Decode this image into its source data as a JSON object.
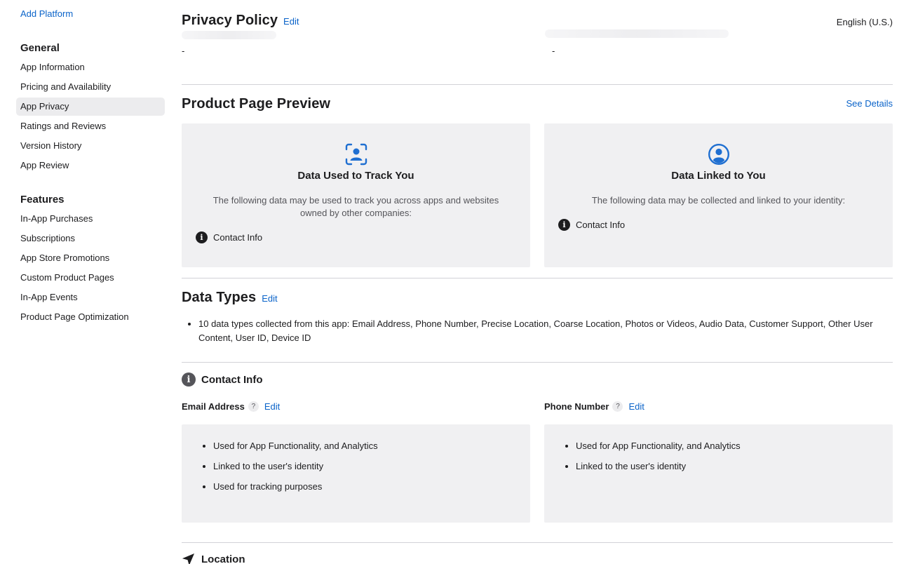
{
  "sidebar": {
    "add_platform": "Add Platform",
    "general_title": "General",
    "general_items": [
      "App Information",
      "Pricing and Availability",
      "App Privacy",
      "Ratings and Reviews",
      "Version History",
      "App Review"
    ],
    "features_title": "Features",
    "features_items": [
      "In-App Purchases",
      "Subscriptions",
      "App Store Promotions",
      "Custom Product Pages",
      "In-App Events",
      "Product Page Optimization"
    ],
    "active_item": "App Privacy"
  },
  "privacy_policy": {
    "title": "Privacy Policy",
    "edit": "Edit",
    "language": "English (U.S.)",
    "url_value": "-",
    "choices_url_value": "-"
  },
  "product_page_preview": {
    "title": "Product Page Preview",
    "see_details": "See Details",
    "track_card": {
      "icon": "person-viewfinder-icon",
      "title": "Data Used to Track You",
      "description": "The following data may be used to track you across apps and websites owned by other companies:",
      "item": "Contact Info"
    },
    "linked_card": {
      "icon": "person-circle-icon",
      "title": "Data Linked to You",
      "description": "The following data may be collected and linked to your identity:",
      "item": "Contact Info"
    }
  },
  "data_types": {
    "title": "Data Types",
    "edit": "Edit",
    "summary": "10 data types collected from this app: Email Address, Phone Number, Precise Location, Coarse Location, Photos or Videos, Audio Data, Customer Support, Other User Content, User ID, Device ID"
  },
  "contact_info": {
    "title": "Contact Info",
    "email": {
      "label": "Email Address",
      "help": "?",
      "edit": "Edit",
      "uses": [
        "Used for App Functionality, and Analytics",
        "Linked to the user's identity",
        "Used for tracking purposes"
      ]
    },
    "phone": {
      "label": "Phone Number",
      "help": "?",
      "edit": "Edit",
      "uses": [
        "Used for App Functionality, and Analytics",
        "Linked to the user's identity"
      ]
    }
  },
  "location": {
    "title": "Location"
  },
  "colors": {
    "link": "#0a63c9",
    "card_bg": "#f0f0f2",
    "icon_blue": "#1f6fd1",
    "divider": "#d2d2d7"
  }
}
